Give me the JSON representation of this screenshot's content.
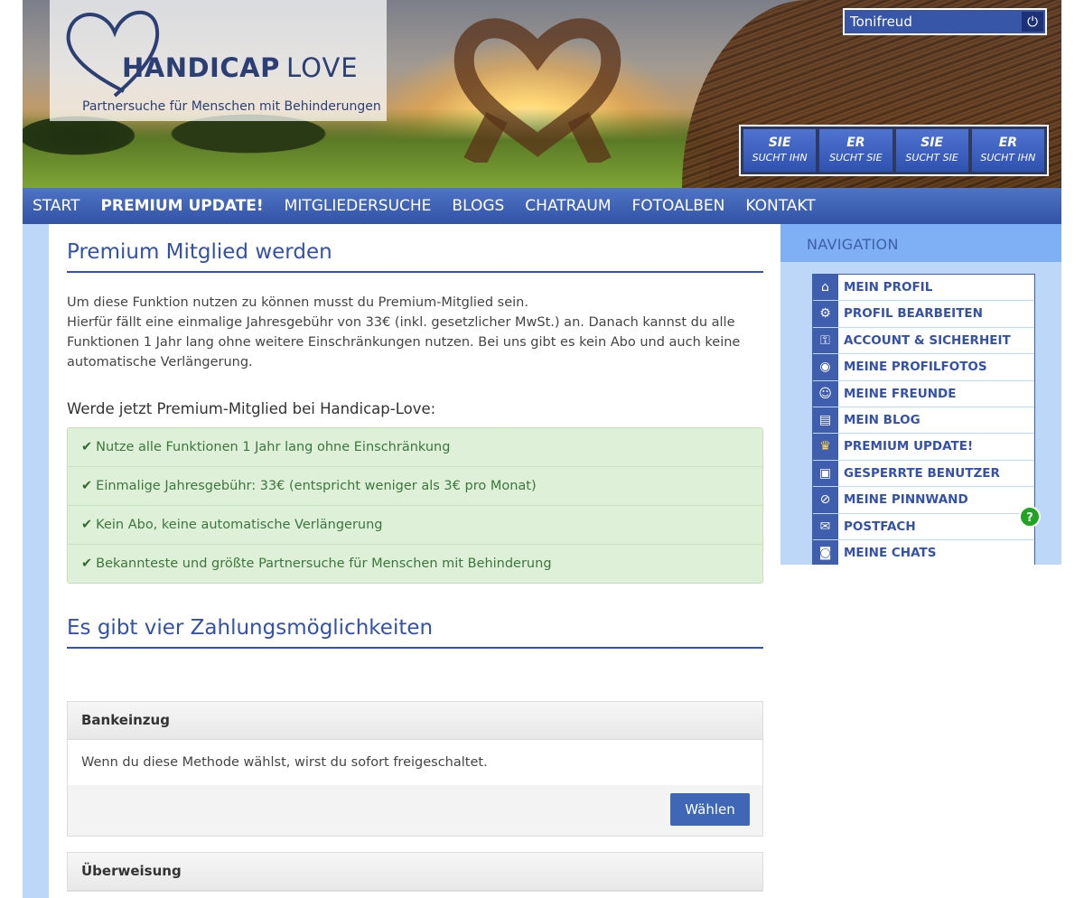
{
  "header": {
    "logo_handicap": "HANDICAP",
    "logo_love": "LOVE",
    "logo_subtitle": "Partnersuche für Menschen mit Behinderungen",
    "username": "Tonifreud",
    "search_buttons": [
      {
        "top": "SIE",
        "bottom": "SUCHT IHN"
      },
      {
        "top": "ER",
        "bottom": "SUCHT SIE"
      },
      {
        "top": "SIE",
        "bottom": "SUCHT SIE"
      },
      {
        "top": "ER",
        "bottom": "SUCHT IHN"
      }
    ]
  },
  "nav": [
    "START",
    "PREMIUM UPDATE!",
    "MITGLIEDERSUCHE",
    "BLOGS",
    "CHATRAUM",
    "FOTOALBEN",
    "KONTAKT"
  ],
  "main": {
    "title": "Premium Mitglied werden",
    "intro_line1": "Um diese Funktion nutzen zu können musst du Premium-Mitglied sein.",
    "intro_line2": "Hierfür fällt eine einmalige Jahresgebühr von 33€ (inkl. gesetzlicher MwSt.) an. Danach kannst du alle Funktionen 1 Jahr lang ohne weitere Einschränkungen nutzen. Bei uns gibt es kein Abo und auch keine automatische Verlängerung.",
    "werde": "Werde jetzt Premium-Mitglied bei Handicap-Love:",
    "benefits": [
      "Nutze alle Funktionen 1 Jahr lang ohne Einschränkung",
      "Einmalige Jahresgebühr: 33€ (entspricht weniger als 3€ pro Monat)",
      "Kein Abo, keine automatische Verlängerung",
      "Bekannteste und größte Partnersuche für Menschen mit Behinderung"
    ],
    "payment_title": "Es gibt vier Zahlungsmöglichkeiten",
    "payments": [
      {
        "title": "Bankeinzug",
        "text": "Wenn du diese Methode wählst, wirst du sofort freigeschaltet.",
        "button": "Wählen"
      },
      {
        "title": "Überweisung"
      }
    ]
  },
  "sidebar": {
    "title": "NAVIGATION",
    "items": [
      {
        "label": "MEIN PROFIL",
        "icon": "home-icon",
        "glyph": "⌂"
      },
      {
        "label": "PROFIL BEARBEITEN",
        "icon": "gear-icon",
        "glyph": "⚙"
      },
      {
        "label": "ACCOUNT & SICHERHEIT",
        "icon": "key-icon",
        "glyph": "⚿"
      },
      {
        "label": "MEINE PROFILFOTOS",
        "icon": "camera-icon",
        "glyph": "◉"
      },
      {
        "label": "MEINE FREUNDE",
        "icon": "friends-icon",
        "glyph": "☺"
      },
      {
        "label": "MEIN BLOG",
        "icon": "blog-icon",
        "glyph": "▤"
      },
      {
        "label": "PREMIUM UPDATE!",
        "icon": "crown-icon",
        "glyph": "♛"
      },
      {
        "label": "GESPERRTE BENUTZER",
        "icon": "lock-icon",
        "glyph": "▣"
      },
      {
        "label": "MEINE PINNWAND",
        "icon": "paperclip-icon",
        "glyph": "⊘"
      },
      {
        "label": "POSTFACH",
        "icon": "mail-icon",
        "glyph": "✉"
      },
      {
        "label": "MEINE CHATS",
        "icon": "chat-icon",
        "glyph": "◙"
      }
    ],
    "help_badge": "?"
  },
  "colors": {
    "primary": "#3451a6",
    "nav": "#3f5fae",
    "success_bg": "#dff0d8",
    "success_text": "#3c763d",
    "page_bg": "#bcd7f8"
  }
}
